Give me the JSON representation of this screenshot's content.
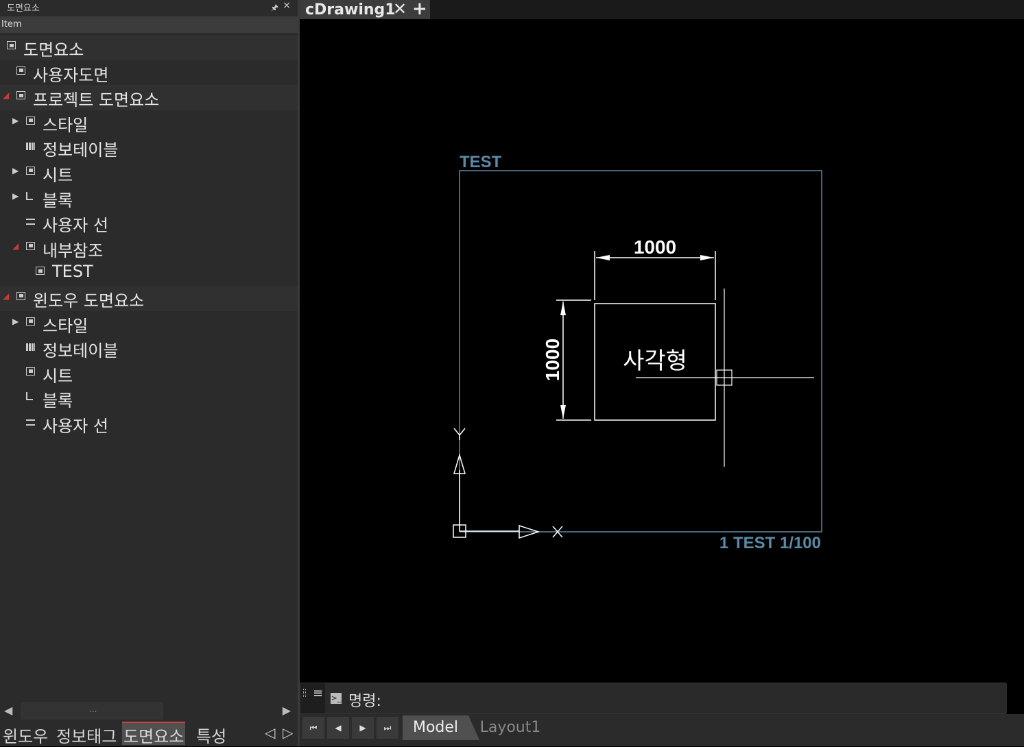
{
  "panel": {
    "title": "도면요소",
    "pin": "🖈",
    "close": "×",
    "column_header": "Item"
  },
  "tree": [
    {
      "label": "도면요소",
      "indent": 0,
      "arrow": "",
      "icon": "drawing-icon",
      "shade": true
    },
    {
      "label": "사용자도면",
      "indent": 1,
      "arrow": "",
      "icon": "user-drawing-icon",
      "shade": false
    },
    {
      "label": "프로젝트 도면요소",
      "indent": 1,
      "arrow": "open",
      "icon": "project-icon",
      "shade": true
    },
    {
      "label": "스타일",
      "indent": 2,
      "arrow": "closed",
      "icon": "style-icon",
      "shade": false
    },
    {
      "label": "정보테이블",
      "indent": 2,
      "arrow": "",
      "icon": "table-icon",
      "shade": false
    },
    {
      "label": "시트",
      "indent": 2,
      "arrow": "closed",
      "icon": "sheet-icon",
      "shade": false
    },
    {
      "label": "블록",
      "indent": 2,
      "arrow": "closed",
      "icon": "block-icon",
      "shade": false
    },
    {
      "label": "사용자 선",
      "indent": 2,
      "arrow": "",
      "icon": "line-icon",
      "shade": false
    },
    {
      "label": "내부참조",
      "indent": 2,
      "arrow": "open",
      "icon": "xref-icon",
      "shade": false
    },
    {
      "label": "TEST",
      "indent": 3,
      "arrow": "",
      "icon": "xref-icon",
      "shade": false
    },
    {
      "label": "윈도우 도면요소",
      "indent": 1,
      "arrow": "open",
      "icon": "window-icon",
      "shade": true
    },
    {
      "label": "스타일",
      "indent": 2,
      "arrow": "closed",
      "icon": "style-icon",
      "shade": false
    },
    {
      "label": "정보테이블",
      "indent": 2,
      "arrow": "",
      "icon": "table-icon",
      "shade": false
    },
    {
      "label": "시트",
      "indent": 2,
      "arrow": "",
      "icon": "sheet-icon",
      "shade": false
    },
    {
      "label": "블록",
      "indent": 2,
      "arrow": "",
      "icon": "block-icon",
      "shade": false
    },
    {
      "label": "사용자 선",
      "indent": 2,
      "arrow": "",
      "icon": "line-icon",
      "shade": false
    }
  ],
  "scroll": {
    "dots": "..."
  },
  "bottom_tabs": [
    {
      "label": "윈도우"
    },
    {
      "label": "정보태그"
    },
    {
      "label": "도면요소",
      "active": true
    },
    {
      "label": "특성"
    }
  ],
  "doc_tab": {
    "name": "cDrawing1",
    "close": "✕",
    "add": "+"
  },
  "drawing": {
    "frame_title": "TEST",
    "frame_caption": "1 TEST 1/100",
    "dim_horizontal": "1000",
    "dim_vertical": "1000",
    "rect_label": "사각형",
    "ucs_y": "Y",
    "ucs_x": "X",
    "frame_color": "#5a8aa8",
    "line_color": "#ffffff"
  },
  "command": {
    "menu": "≡",
    "prompt": "명령:"
  },
  "layout": {
    "nav": [
      "⏮",
      "◀",
      "▶",
      "⏭"
    ],
    "model": "Model",
    "layout1": "Layout1"
  }
}
